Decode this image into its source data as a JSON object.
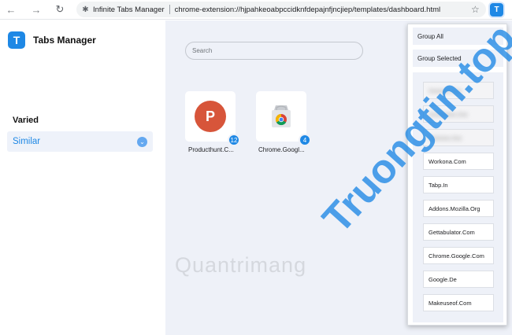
{
  "browser": {
    "extension_name": "Infinite Tabs Manager",
    "url": "chrome-extension://hjpahkeoabpccidknfdepajnfjncjiep/templates/dashboard.html",
    "extension_button_letter": "T"
  },
  "sidebar": {
    "logo_letter": "T",
    "app_title": "Tabs Manager",
    "category_heading": "Varied",
    "active_category": "Similar"
  },
  "main": {
    "search_placeholder": "Search",
    "tiles": [
      {
        "icon_letter": "P",
        "label": "Producthunt.C...",
        "count": "12"
      },
      {
        "icon_letter": "",
        "label": "Chrome.Googl...",
        "count": "4"
      }
    ]
  },
  "popup": {
    "group_all": "Group All",
    "group_selected": "Group Selected",
    "hidden_entries": [
      "Xxxxxxx.Xxx",
      "Xxxxxxxxx.Xxx",
      "Xxxxxxx.Xxx"
    ],
    "domains": [
      "Workona.Com",
      "Tabp.In",
      "Addons.Mozilla.Org",
      "Gettabulator.Com",
      "Chrome.Google.Com",
      "Google.De",
      "Makeuseof.Com"
    ]
  },
  "watermark": {
    "left": "Quantrimang",
    "right": "Truongtin.top"
  },
  "colors": {
    "accent": "#1e88e5",
    "producthunt": "#d7553a",
    "panel_bg": "#eef1f8"
  }
}
